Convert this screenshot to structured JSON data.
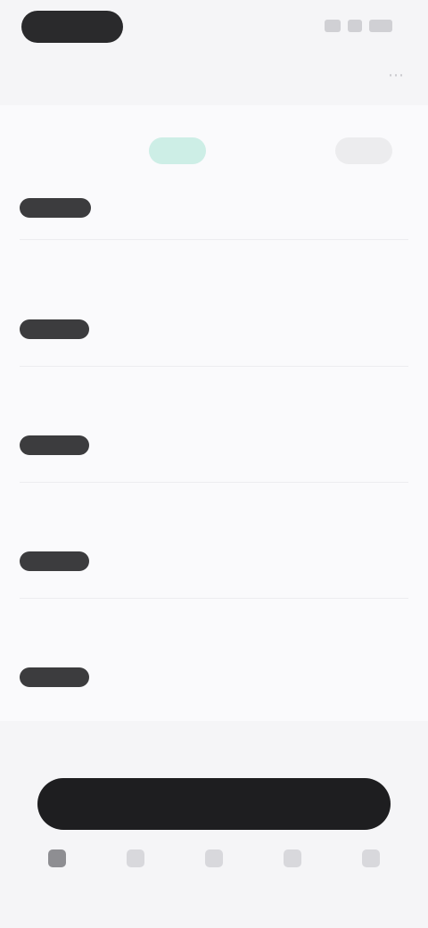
{
  "status_bar": {
    "icons": [
      "signal-icon",
      "wifi-icon",
      "battery-icon"
    ]
  },
  "nav": {
    "title": "",
    "action_icon": "more-icon"
  },
  "headline": {
    "text": "",
    "badge": "",
    "badge_secondary": ""
  },
  "rows": [
    {
      "label": "",
      "value": ""
    },
    {
      "label": "",
      "value": ""
    },
    {
      "label": "",
      "value": ""
    },
    {
      "label": "",
      "value": ""
    }
  ],
  "primary_button": {
    "label": ""
  },
  "tabs": [
    {
      "icon": "home-icon",
      "label": ""
    },
    {
      "icon": "search-icon",
      "label": ""
    },
    {
      "icon": "add-icon",
      "label": ""
    },
    {
      "icon": "chat-icon",
      "label": ""
    },
    {
      "icon": "profile-icon",
      "label": ""
    }
  ],
  "colors": {
    "badge_bg": "#cdeee6",
    "badge_text": "#3aa88a",
    "button_bg": "#1e1e20"
  }
}
